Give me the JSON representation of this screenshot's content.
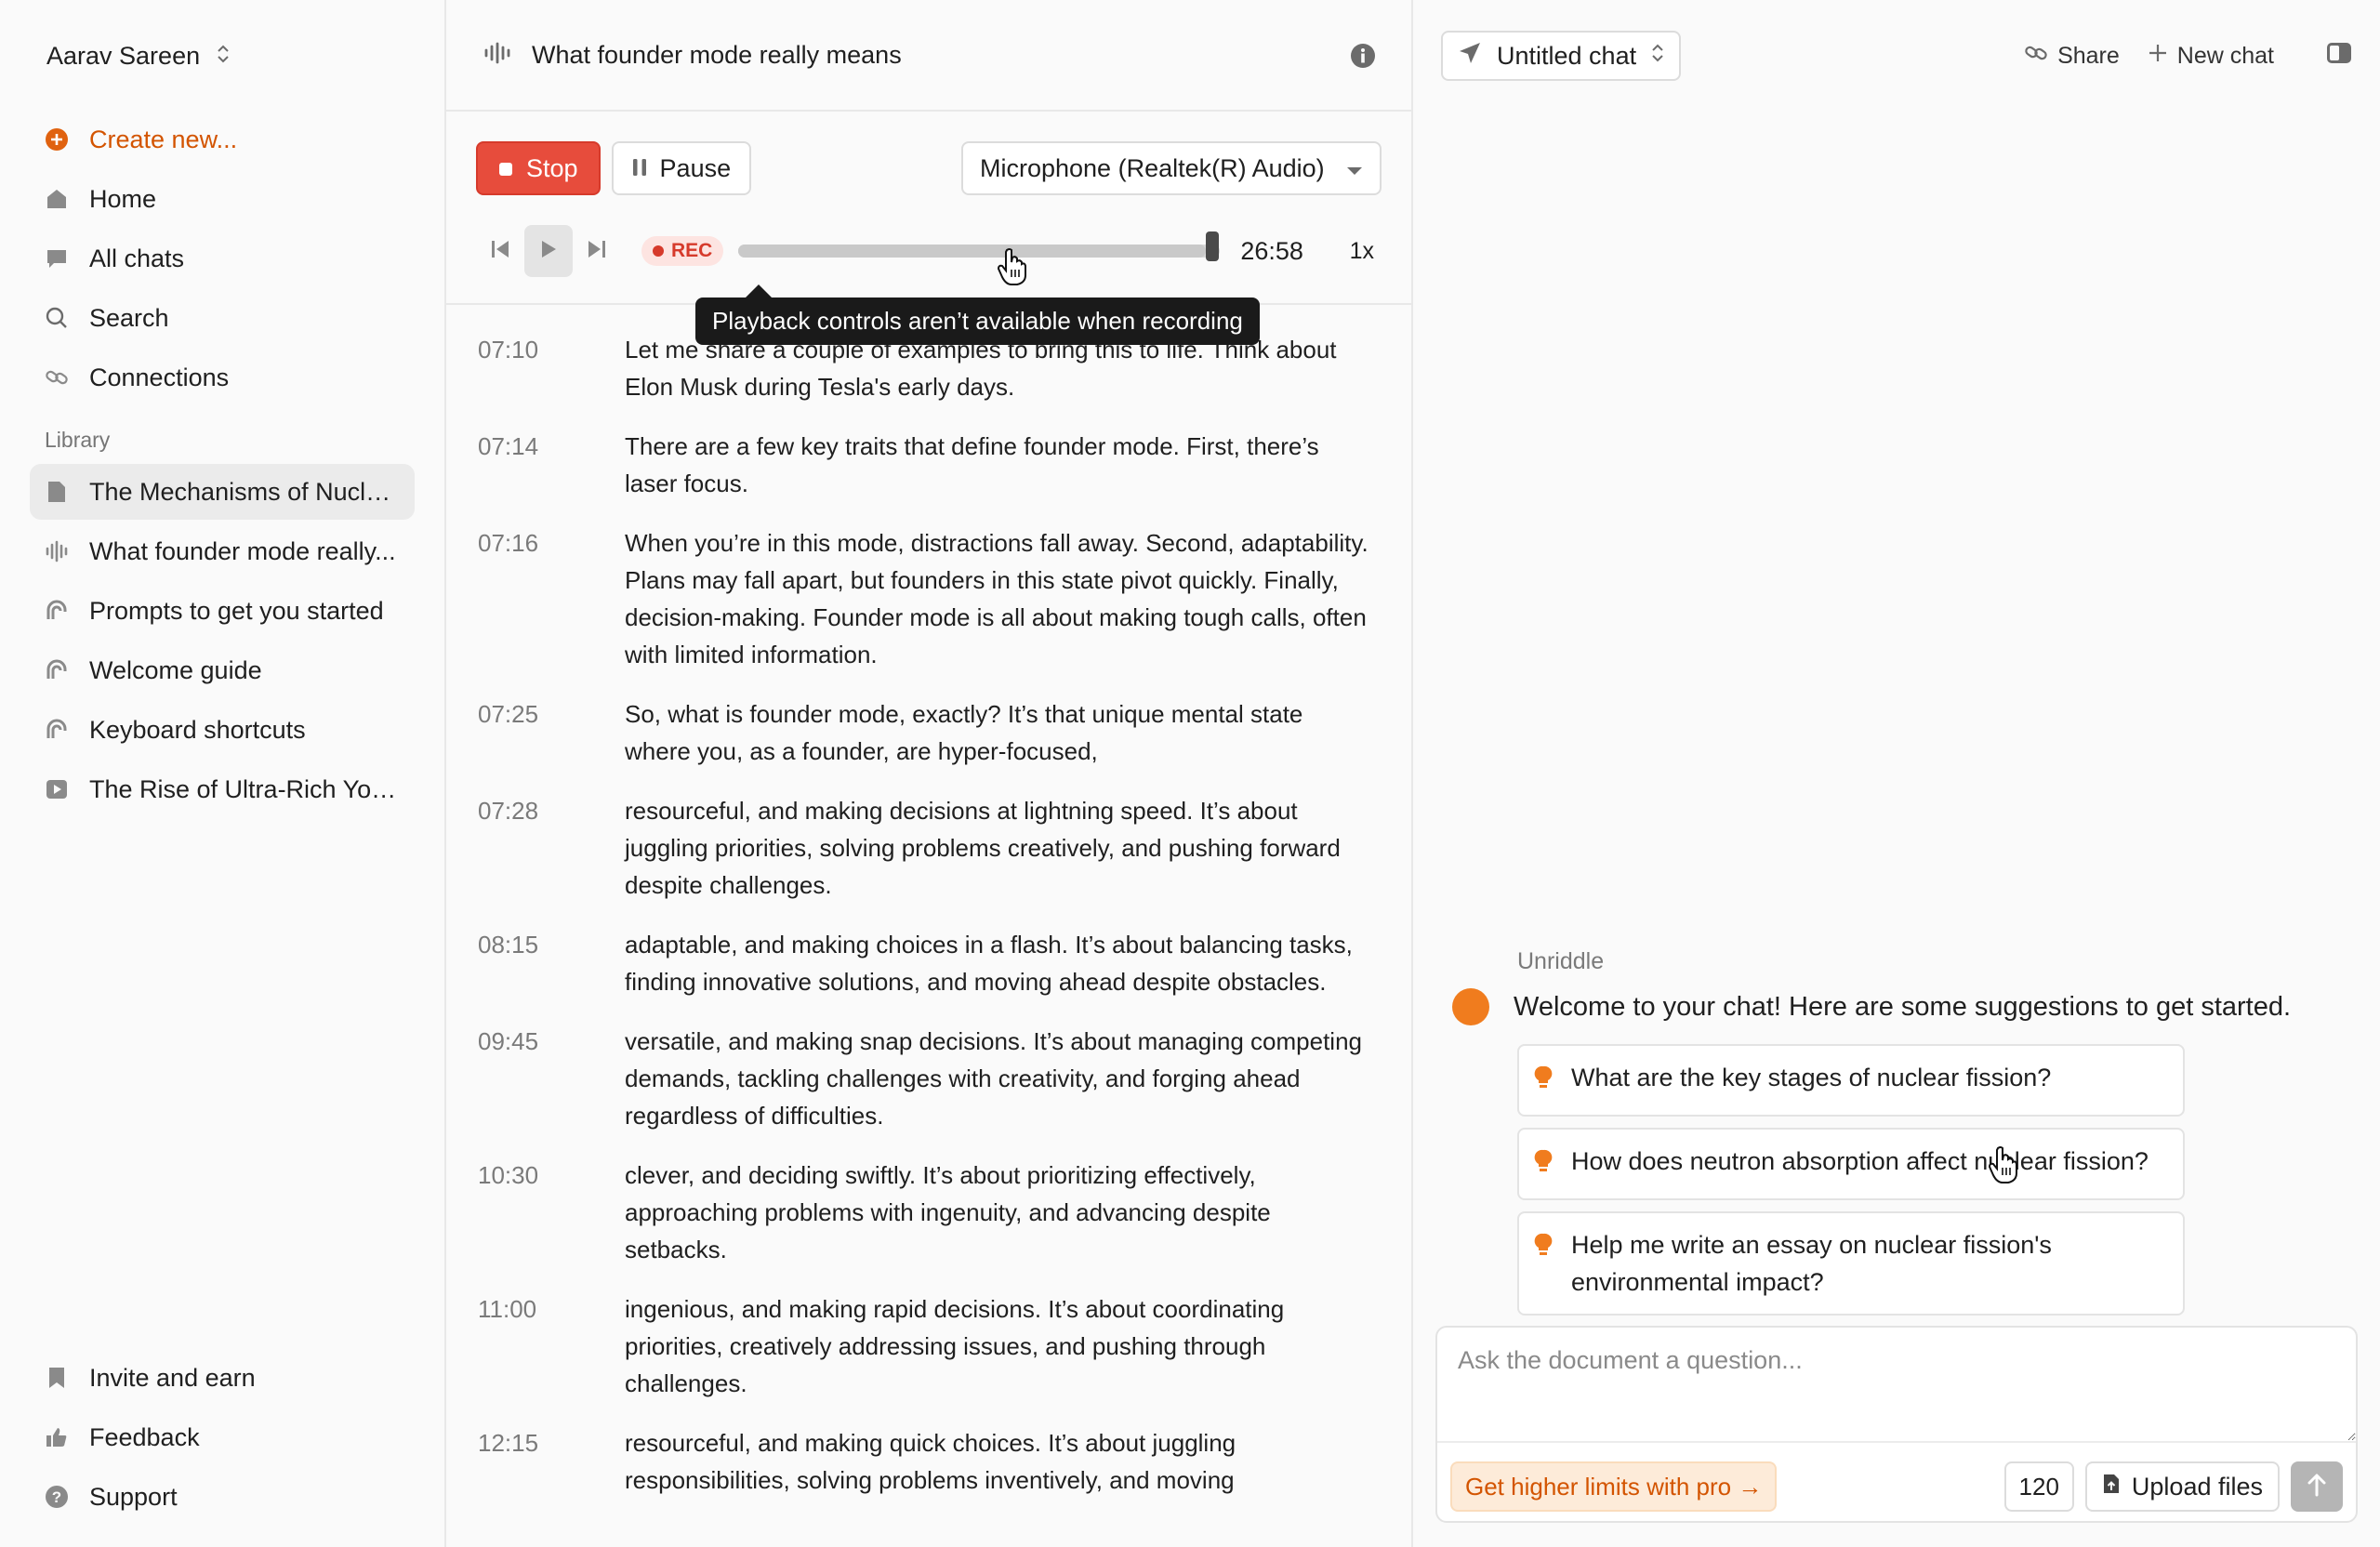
{
  "sidebar": {
    "user_name": "Aarav Sareen",
    "create_label": "Create new...",
    "nav": [
      {
        "label": "Home",
        "icon": "home-icon"
      },
      {
        "label": "All chats",
        "icon": "chat-bubble-icon"
      },
      {
        "label": "Search",
        "icon": "search-icon"
      },
      {
        "label": "Connections",
        "icon": "link-icon"
      }
    ],
    "library_label": "Library",
    "library": [
      {
        "label": "The Mechanisms of Nucle...",
        "icon": "document-icon",
        "active": true
      },
      {
        "label": "What founder mode really...",
        "icon": "audio-wave-icon"
      },
      {
        "label": "Prompts to get you started",
        "icon": "article-icon"
      },
      {
        "label": "Welcome guide",
        "icon": "article-icon"
      },
      {
        "label": "Keyboard shortcuts",
        "icon": "article-icon"
      },
      {
        "label": "The Rise of Ultra-Rich You...",
        "icon": "video-icon"
      }
    ],
    "bottom": [
      {
        "label": "Invite and earn",
        "icon": "bookmark-icon"
      },
      {
        "label": "Feedback",
        "icon": "thumbs-up-icon"
      },
      {
        "label": "Support",
        "icon": "help-icon"
      }
    ]
  },
  "recording": {
    "title": "What founder mode really means",
    "stop_label": "Stop",
    "pause_label": "Pause",
    "microphone": "Microphone (Realtek(R) Audio)",
    "rec_label": "REC",
    "elapsed": "26:58",
    "speed": "1x",
    "progress_fraction": 0.97,
    "tooltip": "Playback controls aren’t available when recording"
  },
  "transcript": [
    {
      "time": "07:10",
      "text": "Let me share a couple of examples to bring this to life. Think about Elon Musk during Tesla's early days."
    },
    {
      "time": "07:14",
      "text": "There are a few key traits that define founder mode. First, there’s laser focus."
    },
    {
      "time": "07:16",
      "text": "When you’re in this mode, distractions fall away. Second, adaptability. Plans may fall apart, but founders in this state pivot quickly. Finally, decision-making. Founder mode is all about making tough calls, often with limited information."
    },
    {
      "time": "07:25",
      "text": "So, what is founder mode, exactly? It’s that unique mental state where you, as a founder, are hyper-focused,"
    },
    {
      "time": "07:28",
      "text": "resourceful, and making decisions at lightning speed. It’s about juggling priorities, solving problems creatively, and pushing forward despite challenges."
    },
    {
      "time": "08:15",
      "text": "adaptable, and making choices in a flash. It’s about balancing tasks, finding innovative solutions, and moving ahead despite obstacles."
    },
    {
      "time": "09:45",
      "text": "versatile, and making snap decisions. It’s about managing competing demands, tackling challenges with creativity, and forging ahead regardless of difficulties."
    },
    {
      "time": "10:30",
      "text": "clever, and deciding swiftly. It’s about prioritizing effectively, approaching problems with ingenuity, and advancing despite setbacks."
    },
    {
      "time": "11:00",
      "text": "ingenious, and making rapid decisions. It’s about coordinating priorities, creatively addressing issues, and pushing through challenges."
    },
    {
      "time": "12:15",
      "text": "resourceful, and making quick choices. It’s about juggling responsibilities, solving problems inventively, and moving"
    }
  ],
  "chat": {
    "title": "Untitled chat",
    "share_label": "Share",
    "new_chat_label": "New chat",
    "bot_name": "Unriddle",
    "welcome": "Welcome to your chat! Here are some suggestions to get started.",
    "suggestions": [
      "What are the key stages of nuclear fission?",
      "How does neutron absorption affect nuclear fission?",
      "Help me write an essay on nuclear fission's environmental impact?"
    ],
    "input_placeholder": "Ask the document a question...",
    "pro_label": "Get higher limits with pro →",
    "count": "120",
    "upload_label": "Upload files"
  },
  "colors": {
    "accent_orange": "#d35400",
    "stop_red": "#e74c3c",
    "avatar_orange": "#f07c1e"
  }
}
